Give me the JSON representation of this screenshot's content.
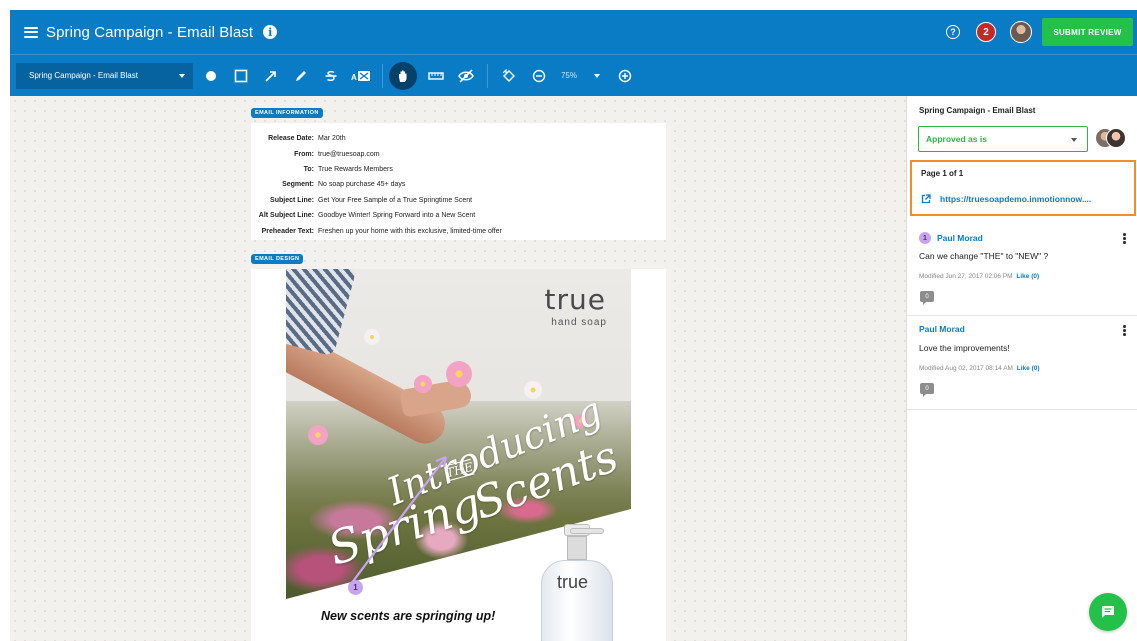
{
  "header": {
    "title": "Spring Campaign - Email Blast",
    "notification_count": "2",
    "submit_label": "SUBMIT REVIEW"
  },
  "toolbar": {
    "document_select": "Spring Campaign - Email Blast",
    "zoom": "75%",
    "tools": [
      "circle-tool",
      "rectangle-tool",
      "arrow-tool",
      "pen-tool",
      "strikethrough-tool",
      "text-replace-tool",
      "hand-tool",
      "measure-tool",
      "hide-annotations-tool",
      "rotate-tool",
      "zoom-out-tool",
      "zoom-in-tool"
    ]
  },
  "canvas": {
    "email_info_label": "EMAIL INFORMATION",
    "email_info": [
      {
        "key": "Release Date:",
        "value": "Mar 20th"
      },
      {
        "key": "From:",
        "value": "true@truesoap.com"
      },
      {
        "key": "To:",
        "value": "True Rewards Members"
      },
      {
        "key": "Segment:",
        "value": "No soap purchase 45+ days"
      },
      {
        "key": "Subject Line:",
        "value": "Get Your Free Sample of a True Springtime Scent"
      },
      {
        "key": "Alt Subject Line:",
        "value": "Goodbye Winter! Spring Forward into a New Scent"
      },
      {
        "key": "Preheader Text:",
        "value": "Freshen up your home with this exclusive, limited-time offer"
      }
    ],
    "email_design_label": "EMAIL DESIGN",
    "brand_name": "true",
    "brand_sub": "hand soap",
    "script_intro": "Introducing",
    "script_the": "THE",
    "script_spring": "Spring",
    "script_scents": "Scents",
    "bottle_label": "true",
    "tagline": "New scents are springing up!",
    "annotation_marker": "1"
  },
  "panel": {
    "title": "Spring Campaign - Email Blast",
    "status": "Approved as is",
    "page_label": "Page 1 of 1",
    "page_link": "https://truesoapdemo.inmotionnow....",
    "comments": [
      {
        "num": "1",
        "author": "Paul Morad",
        "body": "Can we change \"THE\" to \"NEW\" ?",
        "meta": "Modified Jun 27, 2017 02:06 PM",
        "like": "Like (0)",
        "replies": "0"
      },
      {
        "author": "Paul Morad",
        "body": "Love the improvements!",
        "meta": "Modified Aug 02, 2017 08:14 AM",
        "like": "Like (0)",
        "replies": "0"
      }
    ]
  },
  "colors": {
    "brand_blue": "#0a7cc6",
    "approve_green": "#24c14a",
    "highlight_orange": "#f28c28",
    "annotation_purple": "#c8a4f0"
  }
}
